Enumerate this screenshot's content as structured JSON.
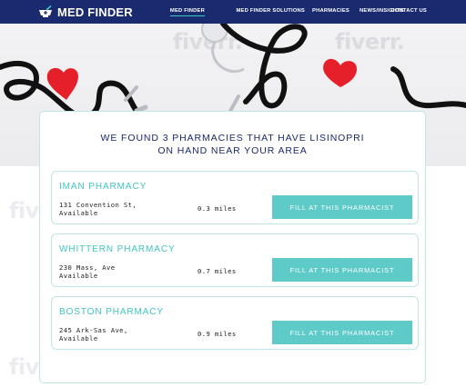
{
  "brand": {
    "name": "MED FINDER",
    "accent": "#3fc7c3",
    "navy": "#1a2a6e"
  },
  "nav": [
    {
      "label": "MED FINDER",
      "active": true
    },
    {
      "label": "MED FINDER SOLUTIONS",
      "active": false
    },
    {
      "label": "PHARMACIES",
      "active": false
    },
    {
      "label": "NEWS/INSIGHTS",
      "active": false
    },
    {
      "label": "CONTACT US",
      "active": false
    }
  ],
  "watermark": "fiverr.",
  "results": {
    "title_line1": "WE FOUND 3 PHARMACIES THAT HAVE LISINOPRI",
    "title_line2": "ON HAND NEAR YOUR AREA"
  },
  "pharmacies": [
    {
      "name": "IMAN PHARMACY",
      "address_line1": "131 Convention St,",
      "address_line2": "Available",
      "distance": "0.3 miles",
      "button": "FILL AT THIS PHARMACIST"
    },
    {
      "name": "WHITTERN PHARMACY",
      "address_line1": "230 Mass, Ave",
      "address_line2": "Available",
      "distance": "0.7 miles",
      "button": "FILL AT THIS PHARMACIST"
    },
    {
      "name": "BOSTON PHARMACY",
      "address_line1": "245 Ark-Sas Ave,",
      "address_line2": "Available",
      "distance": "0.9 miles",
      "button": "FILL AT THIS PHARMACIST"
    }
  ]
}
